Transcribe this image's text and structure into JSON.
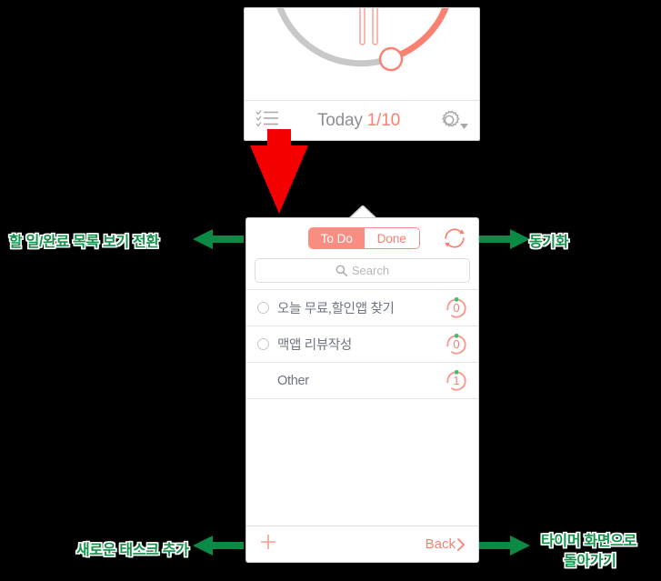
{
  "colors": {
    "accent_salmon": "#fa8072",
    "annotation_green": "#14924a",
    "arrow_green": "#0a8a44",
    "red_arrow": "#f50000",
    "grey_text": "#8e8e93",
    "list_text": "#6e7480",
    "badge_dot_green": "#3cc06a"
  },
  "timer_panel": {
    "name": "timer-screen",
    "arc": {
      "elapsed_color": "#cccccc",
      "remaining_color": "#fa8072",
      "handle_color": "#fa8072"
    },
    "pause_icon": "pause-icon",
    "list_icon": "checklist-icon",
    "date_label": "Today",
    "task_count": "1/10",
    "settings_icon": "gear-icon",
    "settings_caret": "caret-down-icon"
  },
  "list_panel": {
    "name": "task-list-screen",
    "segmented": {
      "options": [
        "To Do",
        "Done"
      ],
      "selected": "To Do"
    },
    "sync_icon": "sync-icon",
    "search": {
      "icon": "search-icon",
      "value": "",
      "placeholder": "Search"
    },
    "tasks": [
      {
        "title": "오늘 무료,할인앱 찾기",
        "count": "0",
        "has_radio": true
      },
      {
        "title": "맥앱 리뷰작성",
        "count": "0",
        "has_radio": true
      },
      {
        "title": "Other",
        "count": "1",
        "has_radio": false
      }
    ],
    "bottom_bar": {
      "add_icon": "plus-icon",
      "back_label": "Back",
      "back_icon": "chevron-right-icon"
    }
  },
  "annotations": [
    {
      "id": "anno-toggle",
      "text": "할 일/완료 목록 보기 전환",
      "direction": "left"
    },
    {
      "id": "anno-sync",
      "text": "동기화",
      "direction": "right"
    },
    {
      "id": "anno-add",
      "text": "새로운 태스크 추가",
      "direction": "left"
    },
    {
      "id": "anno-back-l1",
      "text": "타이머 화면으로",
      "direction": "right"
    },
    {
      "id": "anno-back-l2",
      "text": "돌아가기",
      "direction": "right"
    }
  ]
}
